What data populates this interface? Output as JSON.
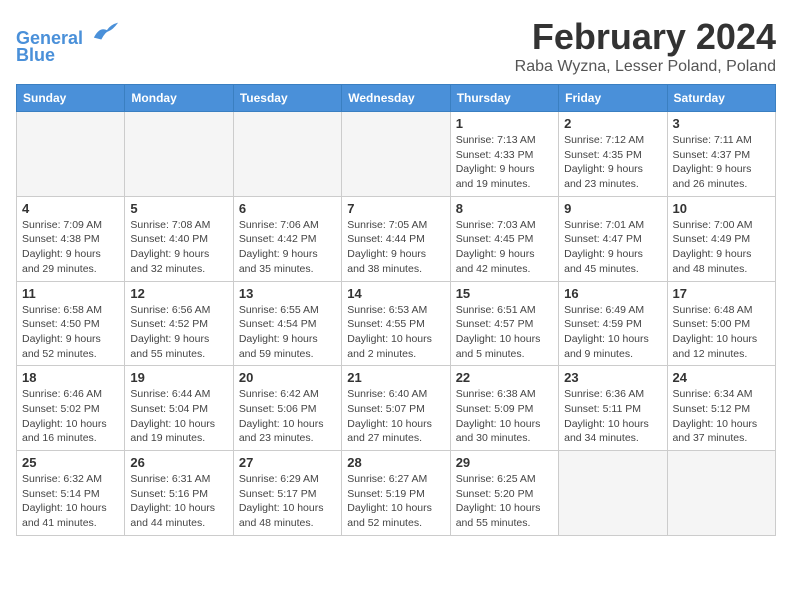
{
  "header": {
    "logo_line1": "General",
    "logo_line2": "Blue",
    "month": "February 2024",
    "location": "Raba Wyzna, Lesser Poland, Poland"
  },
  "weekdays": [
    "Sunday",
    "Monday",
    "Tuesday",
    "Wednesday",
    "Thursday",
    "Friday",
    "Saturday"
  ],
  "weeks": [
    [
      {
        "day": "",
        "info": ""
      },
      {
        "day": "",
        "info": ""
      },
      {
        "day": "",
        "info": ""
      },
      {
        "day": "",
        "info": ""
      },
      {
        "day": "1",
        "info": "Sunrise: 7:13 AM\nSunset: 4:33 PM\nDaylight: 9 hours\nand 19 minutes."
      },
      {
        "day": "2",
        "info": "Sunrise: 7:12 AM\nSunset: 4:35 PM\nDaylight: 9 hours\nand 23 minutes."
      },
      {
        "day": "3",
        "info": "Sunrise: 7:11 AM\nSunset: 4:37 PM\nDaylight: 9 hours\nand 26 minutes."
      }
    ],
    [
      {
        "day": "4",
        "info": "Sunrise: 7:09 AM\nSunset: 4:38 PM\nDaylight: 9 hours\nand 29 minutes."
      },
      {
        "day": "5",
        "info": "Sunrise: 7:08 AM\nSunset: 4:40 PM\nDaylight: 9 hours\nand 32 minutes."
      },
      {
        "day": "6",
        "info": "Sunrise: 7:06 AM\nSunset: 4:42 PM\nDaylight: 9 hours\nand 35 minutes."
      },
      {
        "day": "7",
        "info": "Sunrise: 7:05 AM\nSunset: 4:44 PM\nDaylight: 9 hours\nand 38 minutes."
      },
      {
        "day": "8",
        "info": "Sunrise: 7:03 AM\nSunset: 4:45 PM\nDaylight: 9 hours\nand 42 minutes."
      },
      {
        "day": "9",
        "info": "Sunrise: 7:01 AM\nSunset: 4:47 PM\nDaylight: 9 hours\nand 45 minutes."
      },
      {
        "day": "10",
        "info": "Sunrise: 7:00 AM\nSunset: 4:49 PM\nDaylight: 9 hours\nand 48 minutes."
      }
    ],
    [
      {
        "day": "11",
        "info": "Sunrise: 6:58 AM\nSunset: 4:50 PM\nDaylight: 9 hours\nand 52 minutes."
      },
      {
        "day": "12",
        "info": "Sunrise: 6:56 AM\nSunset: 4:52 PM\nDaylight: 9 hours\nand 55 minutes."
      },
      {
        "day": "13",
        "info": "Sunrise: 6:55 AM\nSunset: 4:54 PM\nDaylight: 9 hours\nand 59 minutes."
      },
      {
        "day": "14",
        "info": "Sunrise: 6:53 AM\nSunset: 4:55 PM\nDaylight: 10 hours\nand 2 minutes."
      },
      {
        "day": "15",
        "info": "Sunrise: 6:51 AM\nSunset: 4:57 PM\nDaylight: 10 hours\nand 5 minutes."
      },
      {
        "day": "16",
        "info": "Sunrise: 6:49 AM\nSunset: 4:59 PM\nDaylight: 10 hours\nand 9 minutes."
      },
      {
        "day": "17",
        "info": "Sunrise: 6:48 AM\nSunset: 5:00 PM\nDaylight: 10 hours\nand 12 minutes."
      }
    ],
    [
      {
        "day": "18",
        "info": "Sunrise: 6:46 AM\nSunset: 5:02 PM\nDaylight: 10 hours\nand 16 minutes."
      },
      {
        "day": "19",
        "info": "Sunrise: 6:44 AM\nSunset: 5:04 PM\nDaylight: 10 hours\nand 19 minutes."
      },
      {
        "day": "20",
        "info": "Sunrise: 6:42 AM\nSunset: 5:06 PM\nDaylight: 10 hours\nand 23 minutes."
      },
      {
        "day": "21",
        "info": "Sunrise: 6:40 AM\nSunset: 5:07 PM\nDaylight: 10 hours\nand 27 minutes."
      },
      {
        "day": "22",
        "info": "Sunrise: 6:38 AM\nSunset: 5:09 PM\nDaylight: 10 hours\nand 30 minutes."
      },
      {
        "day": "23",
        "info": "Sunrise: 6:36 AM\nSunset: 5:11 PM\nDaylight: 10 hours\nand 34 minutes."
      },
      {
        "day": "24",
        "info": "Sunrise: 6:34 AM\nSunset: 5:12 PM\nDaylight: 10 hours\nand 37 minutes."
      }
    ],
    [
      {
        "day": "25",
        "info": "Sunrise: 6:32 AM\nSunset: 5:14 PM\nDaylight: 10 hours\nand 41 minutes."
      },
      {
        "day": "26",
        "info": "Sunrise: 6:31 AM\nSunset: 5:16 PM\nDaylight: 10 hours\nand 44 minutes."
      },
      {
        "day": "27",
        "info": "Sunrise: 6:29 AM\nSunset: 5:17 PM\nDaylight: 10 hours\nand 48 minutes."
      },
      {
        "day": "28",
        "info": "Sunrise: 6:27 AM\nSunset: 5:19 PM\nDaylight: 10 hours\nand 52 minutes."
      },
      {
        "day": "29",
        "info": "Sunrise: 6:25 AM\nSunset: 5:20 PM\nDaylight: 10 hours\nand 55 minutes."
      },
      {
        "day": "",
        "info": ""
      },
      {
        "day": "",
        "info": ""
      }
    ]
  ]
}
